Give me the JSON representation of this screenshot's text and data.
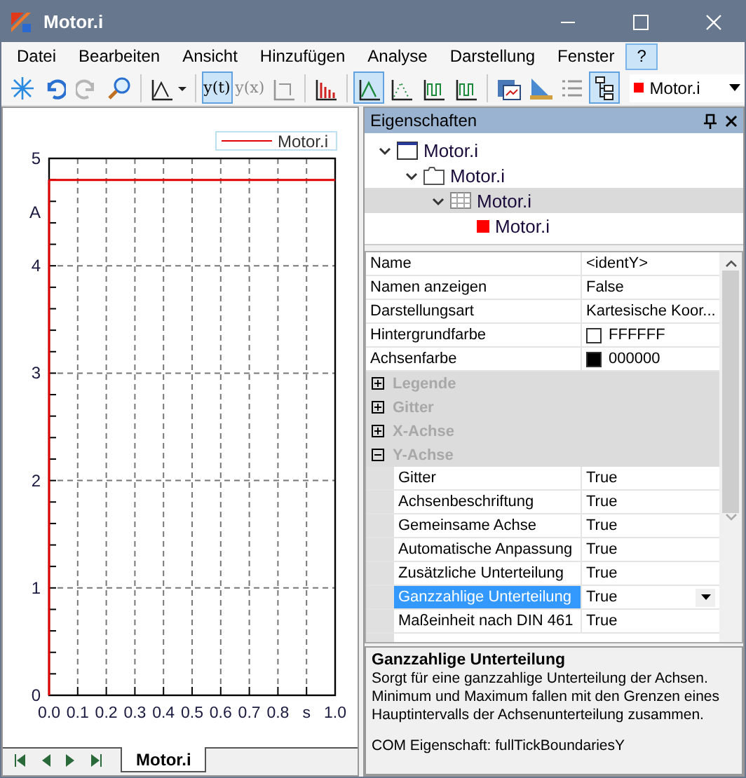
{
  "window": {
    "title": "Motor.i"
  },
  "menu": [
    {
      "label": "Datei",
      "selected": false
    },
    {
      "label": "Bearbeiten",
      "selected": false
    },
    {
      "label": "Ansicht",
      "selected": false
    },
    {
      "label": "Hinzufügen",
      "selected": false
    },
    {
      "label": "Analyse",
      "selected": false
    },
    {
      "label": "Darstellung",
      "selected": false
    },
    {
      "label": "Fenster",
      "selected": false
    },
    {
      "label": "?",
      "selected": true
    }
  ],
  "toolbar": [
    {
      "kind": "snowflake",
      "selected": false,
      "disabled": false
    },
    {
      "kind": "undo",
      "selected": false,
      "disabled": false
    },
    {
      "kind": "redo",
      "selected": false,
      "disabled": true
    },
    {
      "kind": "zoom",
      "selected": false,
      "disabled": false
    },
    {
      "kind": "sep"
    },
    {
      "kind": "chart-menu",
      "selected": false,
      "disabled": false
    },
    {
      "kind": "sep"
    },
    {
      "kind": "text",
      "label": "y(t)",
      "selected": true,
      "disabled": false
    },
    {
      "kind": "text",
      "label": "y(x)",
      "selected": false,
      "disabled": true
    },
    {
      "kind": "axes",
      "selected": false,
      "disabled": true
    },
    {
      "kind": "sep"
    },
    {
      "kind": "bars",
      "selected": false,
      "disabled": false
    },
    {
      "kind": "sep"
    },
    {
      "kind": "line",
      "selected": true,
      "disabled": false
    },
    {
      "kind": "dotted",
      "selected": false,
      "disabled": false
    },
    {
      "kind": "wave",
      "selected": false,
      "disabled": false
    },
    {
      "kind": "wave",
      "selected": false,
      "disabled": false
    },
    {
      "kind": "sep"
    },
    {
      "kind": "print",
      "selected": false,
      "disabled": false
    },
    {
      "kind": "ruler",
      "selected": false,
      "disabled": false
    },
    {
      "kind": "list",
      "selected": false,
      "disabled": true
    },
    {
      "kind": "tree",
      "selected": true,
      "disabled": false
    }
  ],
  "channel_select": {
    "value": "Motor.i",
    "color": "#ff0000"
  },
  "chart": {
    "chart_data": {
      "type": "line",
      "x": [
        0,
        1
      ],
      "series": [
        {
          "name": "Motor.i",
          "color": "#e00000",
          "values": [
            4.8,
            4.8
          ]
        }
      ],
      "xlim": [
        0,
        1
      ],
      "ylim": [
        0,
        5
      ],
      "grid": true,
      "xticks": [
        {
          "value": 0,
          "label": "0.0"
        },
        {
          "value": 0.1,
          "label": "0.1"
        },
        {
          "value": 0.2,
          "label": "0.2"
        },
        {
          "value": 0.3,
          "label": "0.3"
        },
        {
          "value": 0.4,
          "label": "0.4"
        },
        {
          "value": 0.5,
          "label": "0.5"
        },
        {
          "value": 0.6,
          "label": "0.6"
        },
        {
          "value": 0.7,
          "label": "0.7"
        },
        {
          "value": 0.8,
          "label": "0.8"
        },
        {
          "value": 0.9,
          "label": "s"
        },
        {
          "value": 1,
          "label": "1.0"
        }
      ],
      "yticks": [
        0,
        1,
        2,
        3,
        4,
        {
          "value": 4.5,
          "label": "A"
        },
        5
      ]
    }
  },
  "sheet_tabs": [
    {
      "label": "Motor.i",
      "selected": true
    }
  ],
  "properties_panel": {
    "title": "Eigenschaften",
    "tree": [
      {
        "label": "Motor.i",
        "kind": "window",
        "expanded": true,
        "selected": false,
        "children": [
          {
            "label": "Motor.i",
            "kind": "folder",
            "expanded": true,
            "selected": false,
            "children": [
              {
                "label": "Motor.i",
                "kind": "table",
                "expanded": true,
                "selected": true,
                "children": [
                  {
                    "label": "Motor.i",
                    "kind": "channel",
                    "color": "#ff0000",
                    "selected": false
                  }
                ]
              }
            ]
          }
        ]
      }
    ],
    "grid": [
      {
        "kind": "prop",
        "name": "Name",
        "value": "<identY>",
        "selected": false
      },
      {
        "kind": "prop",
        "name": "Namen anzeigen",
        "value": "False",
        "selected": false
      },
      {
        "kind": "prop",
        "name": "Darstellungsart",
        "value": "Kartesische Koor...",
        "selected": false
      },
      {
        "kind": "color",
        "name": "Hintergrundfarbe",
        "value": "FFFFFF",
        "color": "#ffffff",
        "selected": false
      },
      {
        "kind": "color",
        "name": "Achsenfarbe",
        "value": "000000",
        "color": "#000000",
        "selected": false
      },
      {
        "kind": "category",
        "name": "Legende",
        "expanded": false
      },
      {
        "kind": "category",
        "name": "Gitter",
        "expanded": false
      },
      {
        "kind": "category",
        "name": "X-Achse",
        "expanded": false
      },
      {
        "kind": "category",
        "name": "Y-Achse",
        "expanded": true
      },
      {
        "kind": "sub",
        "name": "Gitter",
        "value": "True",
        "selected": false
      },
      {
        "kind": "sub",
        "name": "Achsenbeschriftung",
        "value": "True",
        "selected": false
      },
      {
        "kind": "sub",
        "name": "Gemeinsame Achse",
        "value": "True",
        "selected": false
      },
      {
        "kind": "sub",
        "name": "Automatische Anpassung",
        "value": "True",
        "selected": false
      },
      {
        "kind": "sub",
        "name": "Zusätzliche Unterteilung",
        "value": "True",
        "selected": false
      },
      {
        "kind": "sub",
        "name": "Ganzzahlige Unterteilung",
        "value": "True",
        "selected": true
      },
      {
        "kind": "sub",
        "name": "Maßeinheit nach DIN 461",
        "value": "True",
        "selected": false
      }
    ],
    "description": {
      "title": "Ganzzahlige Unterteilung",
      "text": "Sorgt für eine ganzzahlige Unterteilung der Achsen. Minimum und Maximum fallen mit den Grenzen eines Hauptintervalls der Achsenunterteilung zusammen.",
      "com": "COM Eigenschaft: fullTickBoundariesY"
    }
  }
}
